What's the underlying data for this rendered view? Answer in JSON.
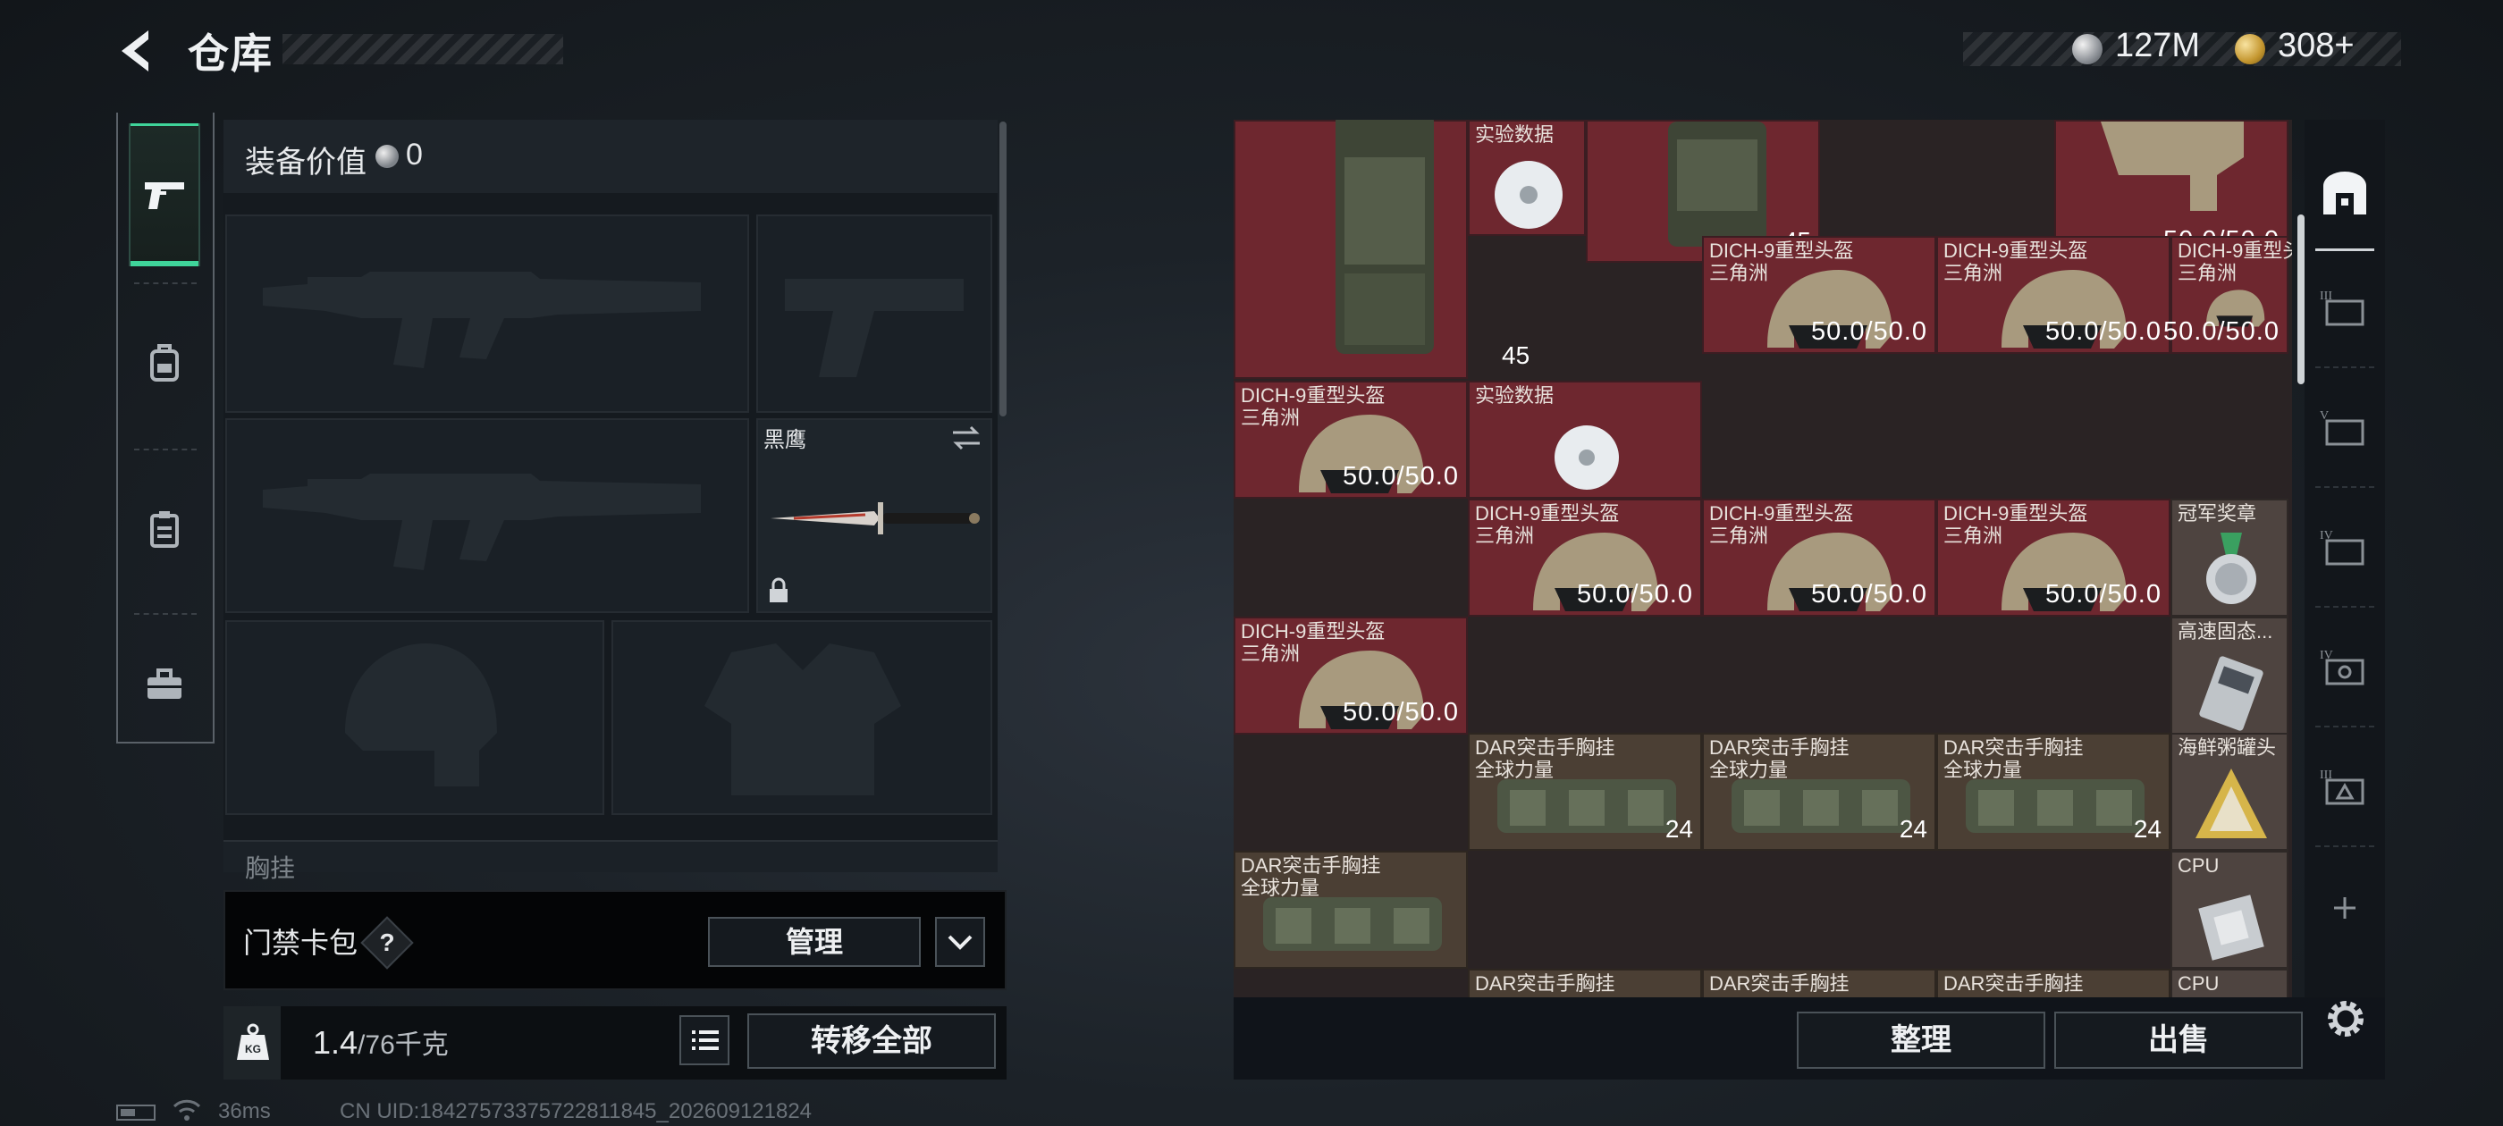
{
  "header": {
    "title": "仓库",
    "currency": [
      {
        "icon": "silver-coin-icon",
        "value": "127M"
      },
      {
        "icon": "gold-coin-icon",
        "value": "308+"
      }
    ]
  },
  "left_tabs": [
    {
      "icon": "pistol-icon",
      "active": true
    },
    {
      "icon": "backpack-icon",
      "active": false
    },
    {
      "icon": "clipboard-icon",
      "active": false
    },
    {
      "icon": "toolbox-icon",
      "active": false
    }
  ],
  "equipment": {
    "label": "装备价值",
    "value": "0",
    "knife_name": "黑鹰",
    "chest_label": "胸挂"
  },
  "keycard": {
    "label": "门禁卡包",
    "help": "?",
    "manage_label": "管理"
  },
  "weight": {
    "current": "1.4",
    "max": "/76千克",
    "transfer_label": "转移全部"
  },
  "status": {
    "ping": "36ms",
    "uid": "CN UID:18427573375722811845_202609121824"
  },
  "stash": {
    "items": [
      {
        "name": "实验数据",
        "value": "",
        "kind": "disc"
      },
      {
        "name": "",
        "value": "45",
        "kind": "pack-count"
      },
      {
        "name": "",
        "value": "45",
        "kind": "pack-count"
      },
      {
        "name": "",
        "value": "50.0/50.0",
        "kind": "helmet"
      },
      {
        "name": "DICH-9重型头盔\n三角洲",
        "value": "50.0/50.0",
        "kind": "helmet"
      },
      {
        "name": "DICH-9重型头盔\n三角洲",
        "value": "50.0/50.0",
        "kind": "helmet"
      },
      {
        "name": "DICH-9重型头盔\n三角洲",
        "value": "50.0/50.0",
        "kind": "helmet"
      },
      {
        "name": "DICH-9重型头盔\n三角洲",
        "value": "50.0/50.0",
        "kind": "helmet"
      },
      {
        "name": "实验数据",
        "value": "",
        "kind": "disc"
      },
      {
        "name": "DICH-9重型头盔\n三角洲",
        "value": "50.0/50.0",
        "kind": "helmet"
      },
      {
        "name": "DICH-9重型头盔\n三角洲",
        "value": "50.0/50.0",
        "kind": "helmet"
      },
      {
        "name": "DICH-9重型头盔\n三角洲",
        "value": "50.0/50.0",
        "kind": "helmet"
      },
      {
        "name": "冠军奖章",
        "value": "",
        "kind": "medal"
      },
      {
        "name": "DICH-9重型头盔\n三角洲",
        "value": "50.0/50.0",
        "kind": "helmet"
      },
      {
        "name": "高速固态...",
        "value": "",
        "kind": "ssd"
      },
      {
        "name": "DAR突击手胸挂\n全球力量",
        "value": "24",
        "kind": "rig"
      },
      {
        "name": "DAR突击手胸挂\n全球力量",
        "value": "24",
        "kind": "rig"
      },
      {
        "name": "DAR突击手胸挂\n全球力量",
        "value": "24",
        "kind": "rig"
      },
      {
        "name": "海鲜粥罐头",
        "value": "",
        "kind": "can"
      },
      {
        "name": "DAR突击手胸挂\n全球力量",
        "value": "",
        "kind": "rig"
      },
      {
        "name": "CPU",
        "value": "",
        "kind": "cpu"
      },
      {
        "name": "DAR突击手胸挂",
        "value": "",
        "kind": "rig"
      },
      {
        "name": "DAR突击手胸挂",
        "value": "",
        "kind": "rig"
      },
      {
        "name": "DAR突击手胸挂",
        "value": "",
        "kind": "rig"
      },
      {
        "name": "CPU",
        "value": "",
        "kind": "cpu"
      }
    ],
    "sort_label": "整理",
    "sell_label": "出售"
  },
  "right_tabs": [
    {
      "icon": "stash-home-icon",
      "active": true
    },
    {
      "icon": "tier-3-storage-icon"
    },
    {
      "icon": "tier-5-storage-icon"
    },
    {
      "icon": "tier-4-storage-icon"
    },
    {
      "icon": "tier-4-safe-icon"
    },
    {
      "icon": "tier-3-safe-icon"
    },
    {
      "icon": "add-icon"
    }
  ],
  "colors": {
    "accent_green": "#3fd49a",
    "item_red": "#6e272f",
    "item_olive": "#4b3f34"
  }
}
